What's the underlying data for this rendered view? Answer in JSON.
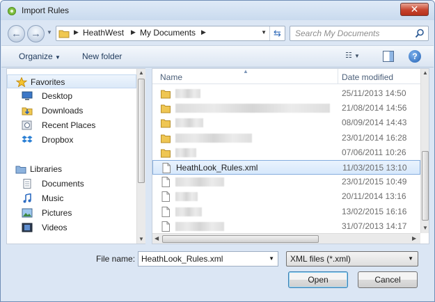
{
  "window": {
    "title": "Import Rules"
  },
  "address": {
    "breadcrumbs": [
      "HeathWest",
      "My Documents"
    ],
    "search_placeholder": "Search My Documents"
  },
  "toolbar": {
    "organize": "Organize",
    "new_folder": "New folder"
  },
  "nav": {
    "favorites": {
      "label": "Favorites",
      "items": [
        {
          "label": "Desktop",
          "icon": "desktop-icon"
        },
        {
          "label": "Downloads",
          "icon": "downloads-folder-icon"
        },
        {
          "label": "Recent Places",
          "icon": "recent-places-icon"
        },
        {
          "label": "Dropbox",
          "icon": "dropbox-icon"
        }
      ]
    },
    "libraries": {
      "label": "Libraries",
      "items": [
        {
          "label": "Documents",
          "icon": "documents-icon"
        },
        {
          "label": "Music",
          "icon": "music-icon"
        },
        {
          "label": "Pictures",
          "icon": "pictures-icon"
        },
        {
          "label": "Videos",
          "icon": "videos-icon"
        }
      ]
    }
  },
  "files": {
    "columns": {
      "name": "Name",
      "date": "Date modified"
    },
    "rows": [
      {
        "type": "folder",
        "name": "",
        "date": "25/11/2013 14:50"
      },
      {
        "type": "folder",
        "name": "",
        "date": "21/08/2014 14:56"
      },
      {
        "type": "folder",
        "name": "",
        "date": "08/09/2014 14:43"
      },
      {
        "type": "folder",
        "name": "",
        "date": "23/01/2014 16:28"
      },
      {
        "type": "folder",
        "name": "",
        "date": "07/06/2011 10:26"
      },
      {
        "type": "file",
        "name": "HeathLook_Rules.xml",
        "date": "11/03/2015 13:10",
        "selected": true
      },
      {
        "type": "file",
        "name": "",
        "date": "23/01/2015 10:49"
      },
      {
        "type": "file",
        "name": "",
        "date": "20/11/2014 13:16"
      },
      {
        "type": "file",
        "name": "",
        "date": "13/02/2015 16:16"
      },
      {
        "type": "file",
        "name": "",
        "date": "31/07/2013 14:17"
      }
    ]
  },
  "bottom": {
    "file_name_label": "File name:",
    "file_name_value": "HeathLook_Rules.xml",
    "filter_value": "XML files (*.xml)",
    "open_label": "Open",
    "cancel_label": "Cancel"
  }
}
